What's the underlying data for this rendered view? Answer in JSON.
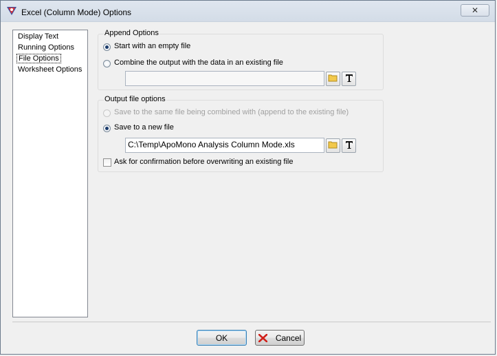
{
  "window": {
    "title": "Excel (Column Mode) Options",
    "close_symbol": "✕"
  },
  "nav": {
    "items": [
      {
        "label": "Display Text"
      },
      {
        "label": "Running Options"
      },
      {
        "label": "File Options"
      },
      {
        "label": "Worksheet Options"
      }
    ],
    "selected": "File Options"
  },
  "append_options": {
    "heading": "Append Options",
    "start_empty_label": "Start with an empty file",
    "start_empty_checked": true,
    "combine_label": "Combine the output with the data in an existing file",
    "combine_checked": false,
    "existing_file_value": ""
  },
  "output_options": {
    "heading": "Output file options",
    "same_file_label": "Save to the same file being combined with (append to the existing file)",
    "same_file_enabled": false,
    "new_file_label": "Save to a new file",
    "new_file_checked": true,
    "new_file_path": "C:\\Temp\\ApoMono Analysis Column Mode.xls",
    "confirm_overwrite_label": "Ask for confirmation before overwriting an existing file",
    "confirm_overwrite_checked": false
  },
  "buttons": {
    "ok": "OK",
    "cancel": "Cancel"
  },
  "icons": {
    "app": "app-icon",
    "folder": "folder-icon",
    "text_template": "text-template-icon",
    "cancel": "red-x-icon"
  },
  "colors": {
    "folder": "#f2c94c",
    "cancel_x": "#d0201a"
  }
}
